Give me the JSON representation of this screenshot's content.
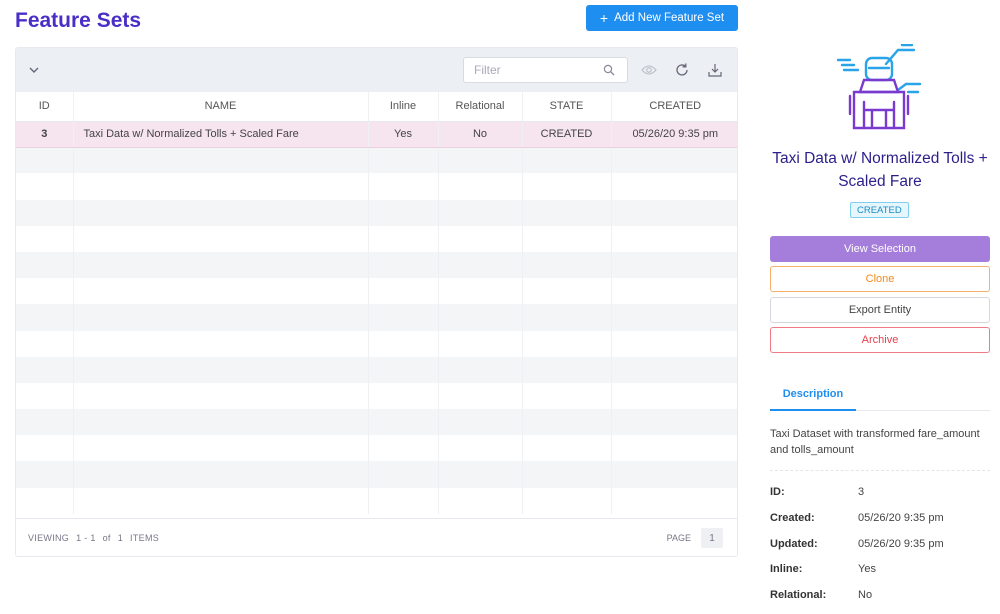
{
  "header": {
    "title": "Feature Sets",
    "add_button": "Add New Feature Set"
  },
  "toolbar": {
    "filter_placeholder": "Filter"
  },
  "table": {
    "columns": [
      "ID",
      "NAME",
      "Inline",
      "Relational",
      "STATE",
      "CREATED"
    ],
    "rows": [
      {
        "id": "3",
        "name": "Taxi Data w/ Normalized Tolls + Scaled Fare",
        "inline": "Yes",
        "relational": "No",
        "state": "CREATED",
        "created": "05/26/20 9:35 pm"
      }
    ]
  },
  "pager": {
    "viewing": "VIEWING",
    "range": "1 - 1",
    "of": "of",
    "total": "1",
    "items": "ITEMS",
    "page_label": "PAGE",
    "page": "1"
  },
  "detail": {
    "title": "Taxi Data w/ Normalized Tolls + Scaled Fare",
    "status": "CREATED",
    "buttons": {
      "view": "View Selection",
      "clone": "Clone",
      "export": "Export Entity",
      "archive": "Archive"
    },
    "tab": "Description",
    "description": "Taxi Dataset with transformed fare_amount and tolls_amount",
    "fields": [
      {
        "key": "ID:",
        "value": "3"
      },
      {
        "key": "Created:",
        "value": "05/26/20 9:35 pm"
      },
      {
        "key": "Updated:",
        "value": "05/26/20 9:35 pm"
      },
      {
        "key": "Inline:",
        "value": "Yes"
      },
      {
        "key": "Relational:",
        "value": "No"
      }
    ]
  },
  "colors": {
    "title": "#4a2fc7",
    "primary": "#1f8ef1",
    "selected_row": "#f6e4ef",
    "view_button": "#a57ddb",
    "clone": "#f08a1c",
    "archive": "#e6414f",
    "icon_blue": "#2aa4e8",
    "icon_purple": "#7a3ad0"
  },
  "icons": [
    "chevron-down-icon",
    "search-icon",
    "eye-icon",
    "refresh-icon",
    "download-icon",
    "plus-icon",
    "robot-icon"
  ]
}
